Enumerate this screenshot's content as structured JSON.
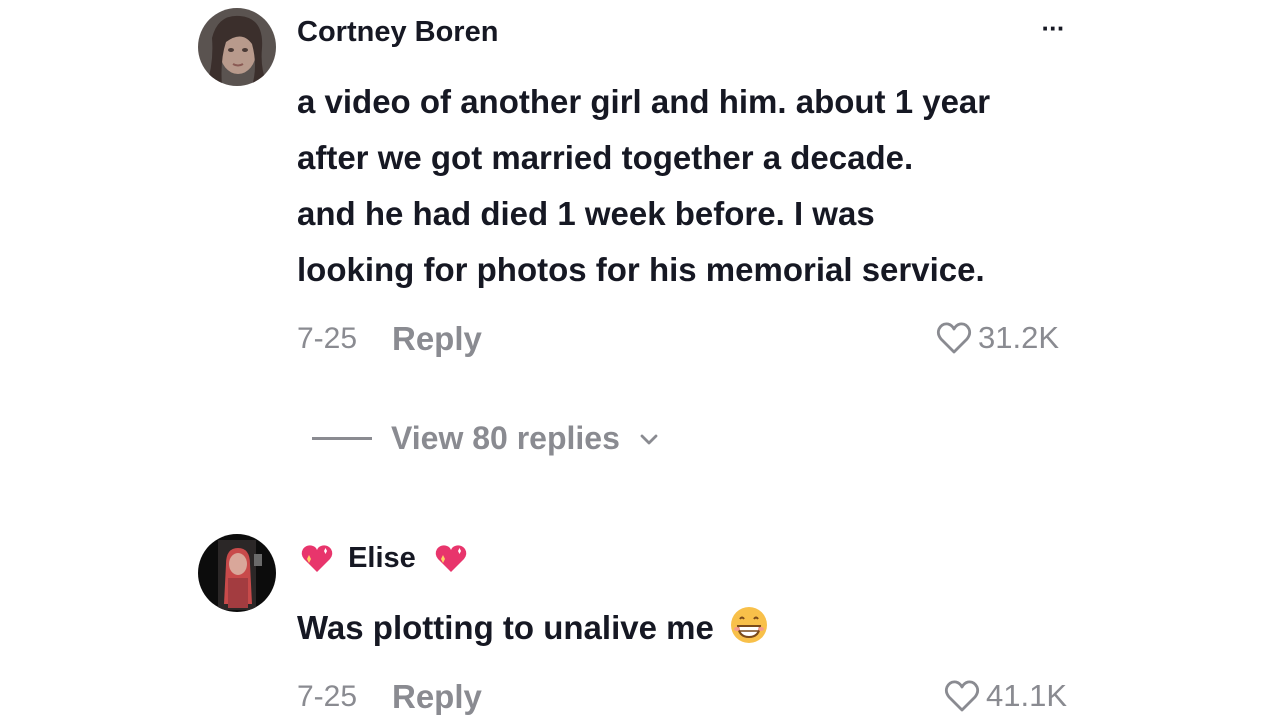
{
  "comments": [
    {
      "username": "Cortney Boren",
      "more_label": "···",
      "lines": [
        "a video of another girl and him. about 1 year",
        "after we got married together a decade.",
        "and he had died 1 week before. I was",
        "looking for photos for his memorial service."
      ],
      "date": "7-25",
      "reply_label": "Reply",
      "likes": "31.2K",
      "view_replies": "View 80 replies"
    },
    {
      "username": "Elise",
      "username_emoji": "sparkling-heart-icon",
      "text": "Was plotting to unalive me",
      "text_emoji": "grinning-face-icon",
      "date": "7-25",
      "reply_label": "Reply",
      "likes": "41.1K"
    }
  ],
  "colors": {
    "primary_text": "#161823",
    "secondary_text": "#8a8b91",
    "heart_emoji": "#e8356c",
    "background": "#ffffff"
  }
}
